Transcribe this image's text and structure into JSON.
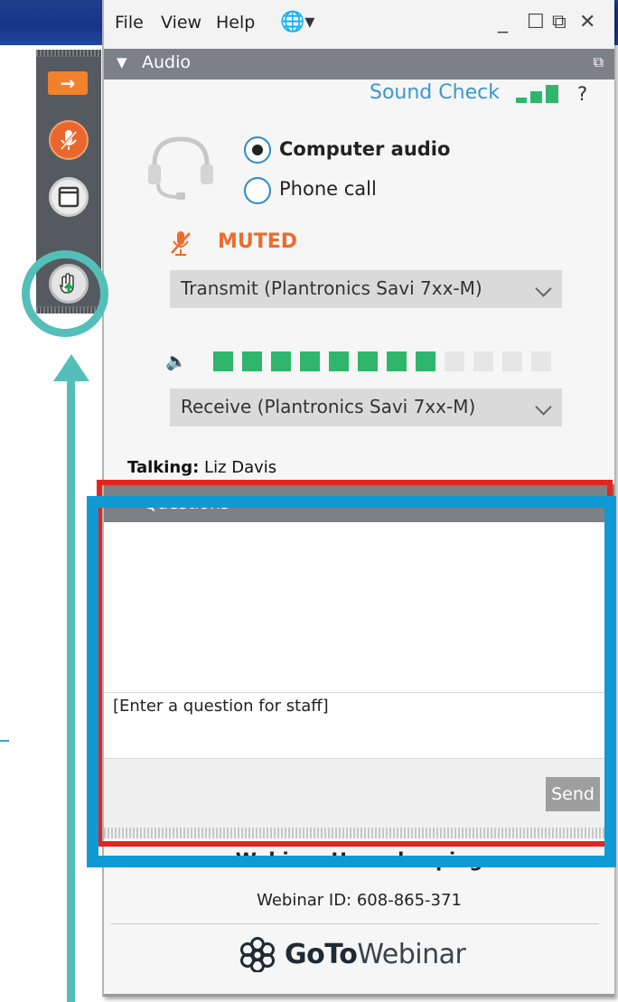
{
  "menu": {
    "file": "File",
    "view": "View",
    "help": "Help",
    "language_icon": "globe-icon",
    "window_controls": {
      "minimize": "_",
      "restore": "☐",
      "popout": "⧉",
      "close": "✕"
    }
  },
  "sidebar": {
    "items": [
      {
        "name": "collapse-arrow",
        "icon": "arrow-right-icon",
        "glyph": "→"
      },
      {
        "name": "mute-mic",
        "icon": "muted-mic-icon"
      },
      {
        "name": "window",
        "icon": "window-icon"
      },
      {
        "name": "raise-hand",
        "icon": "raise-hand-icon"
      }
    ]
  },
  "audio": {
    "title": "Audio",
    "sound_check": "Sound Check",
    "help": "?",
    "options": [
      {
        "label": "Computer audio",
        "selected": true
      },
      {
        "label": "Phone call",
        "selected": false
      }
    ],
    "mic_status": "MUTED",
    "transmit_device": "Transmit (Plantronics Savi 7xx-M)",
    "receive_device": "Receive (Plantronics Savi 7xx-M)",
    "volume_level": 0.6,
    "volume_segments_total": 12,
    "volume_segments_active": 8,
    "colors": {
      "accent": "#2fb66c",
      "muted": "#ef6b2b",
      "link": "#3a98d1"
    }
  },
  "talking": {
    "label": "Talking:",
    "name": "Liz Davis"
  },
  "questions": {
    "title": "Questions",
    "input_placeholder": "[Enter a question for staff]",
    "send": "Send"
  },
  "footer": {
    "title": "Webinar Housekeeping",
    "webinar_id": "Webinar ID: 608-865-371",
    "logo_bold": "GoTo",
    "logo_thin": "Webinar"
  },
  "annotation_colors": {
    "red": "#e52420",
    "blue": "#0f9ad6",
    "teal": "#53bfb8"
  }
}
